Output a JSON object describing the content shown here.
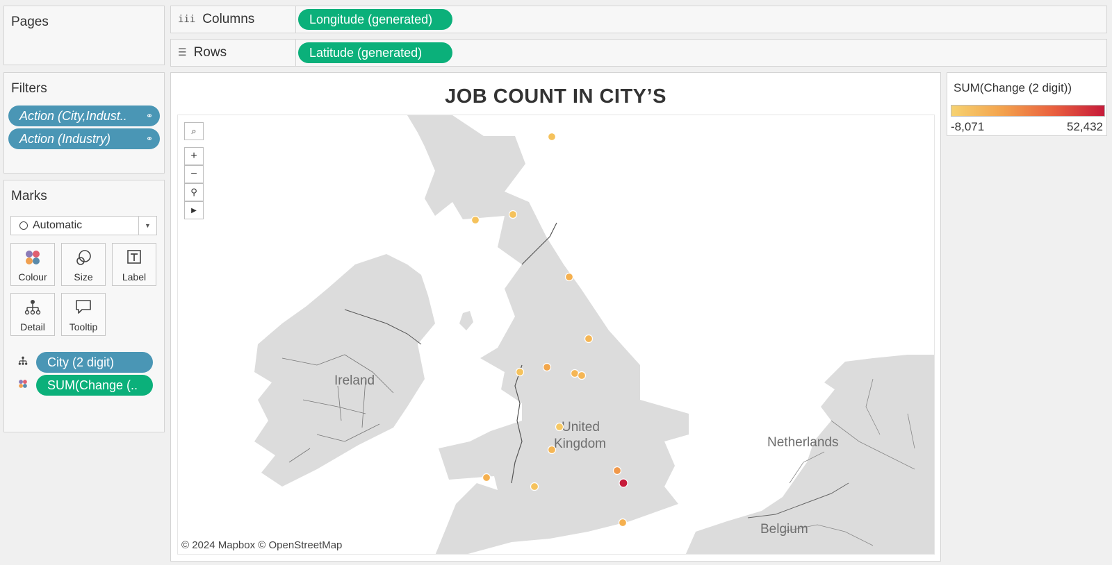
{
  "pages": {
    "title": "Pages"
  },
  "columns": {
    "label": "Columns",
    "icon": "columns-icon",
    "pill": "Longitude (generated)"
  },
  "rows": {
    "label": "Rows",
    "icon": "rows-icon",
    "pill": "Latitude (generated)"
  },
  "filters": {
    "title": "Filters",
    "items": [
      "Action (City,Indust..",
      "Action (Industry)"
    ]
  },
  "marks": {
    "title": "Marks",
    "type": "Automatic",
    "buttons": [
      "Colour",
      "Size",
      "Label",
      "Detail",
      "Tooltip"
    ],
    "fields": [
      {
        "label": "City (2 digit)",
        "icon": "detail-icon",
        "color": "#4a96b5"
      },
      {
        "label": "SUM(Change (..",
        "icon": "colour-icon",
        "color": "#0bb07a"
      }
    ]
  },
  "view": {
    "title": "JOB COUNT IN CITY’S",
    "attribution": "© 2024 Mapbox © OpenStreetMap",
    "map_labels": [
      "Ireland",
      "United",
      "Kingdom",
      "Netherlands",
      "Belgium"
    ]
  },
  "legend": {
    "title": "SUM(Change (2 digit))",
    "min": "-8,071",
    "max": "52,432",
    "colors": [
      "#f6d270",
      "#f3a24d",
      "#e9603e",
      "#c61b3a"
    ]
  }
}
